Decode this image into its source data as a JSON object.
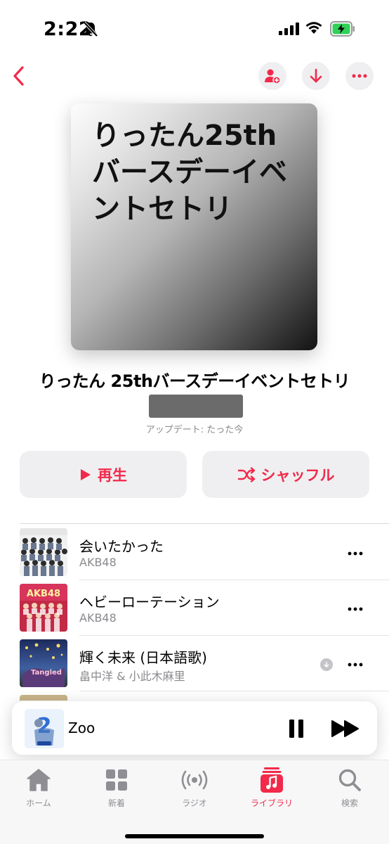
{
  "status_bar": {
    "time": "2:22"
  },
  "navigation": {
    "back_icon": "chevron-left-icon",
    "buttons": [
      "add-person-icon",
      "download-icon",
      "more-icon"
    ]
  },
  "playlist": {
    "artwork_text": "りったん25thバースデーイベントセトリ",
    "title": "りったん 25thバースデーイベントセトリ",
    "updated": "アップデート: たった今"
  },
  "actions": {
    "play_label": "再生",
    "shuffle_label": "シャッフル"
  },
  "tracks": [
    {
      "title": "会いたかった",
      "artist": "AKB48"
    },
    {
      "title": "ヘビーローテーション",
      "artist": "AKB48"
    },
    {
      "title": "輝く未来 (日本語歌)",
      "artist": "畠中洋 & 小此木麻里"
    }
  ],
  "now_playing": {
    "title": "Zoo"
  },
  "tabs": [
    {
      "label": "ホーム",
      "icon": "home-icon"
    },
    {
      "label": "新着",
      "icon": "grid-icon"
    },
    {
      "label": "ラジオ",
      "icon": "radio-icon"
    },
    {
      "label": "ライブラリ",
      "icon": "library-icon",
      "active": true
    },
    {
      "label": "検索",
      "icon": "search-icon"
    }
  ],
  "colors": {
    "accent": "#f2294a",
    "secondary_text": "#8a8a8e"
  }
}
